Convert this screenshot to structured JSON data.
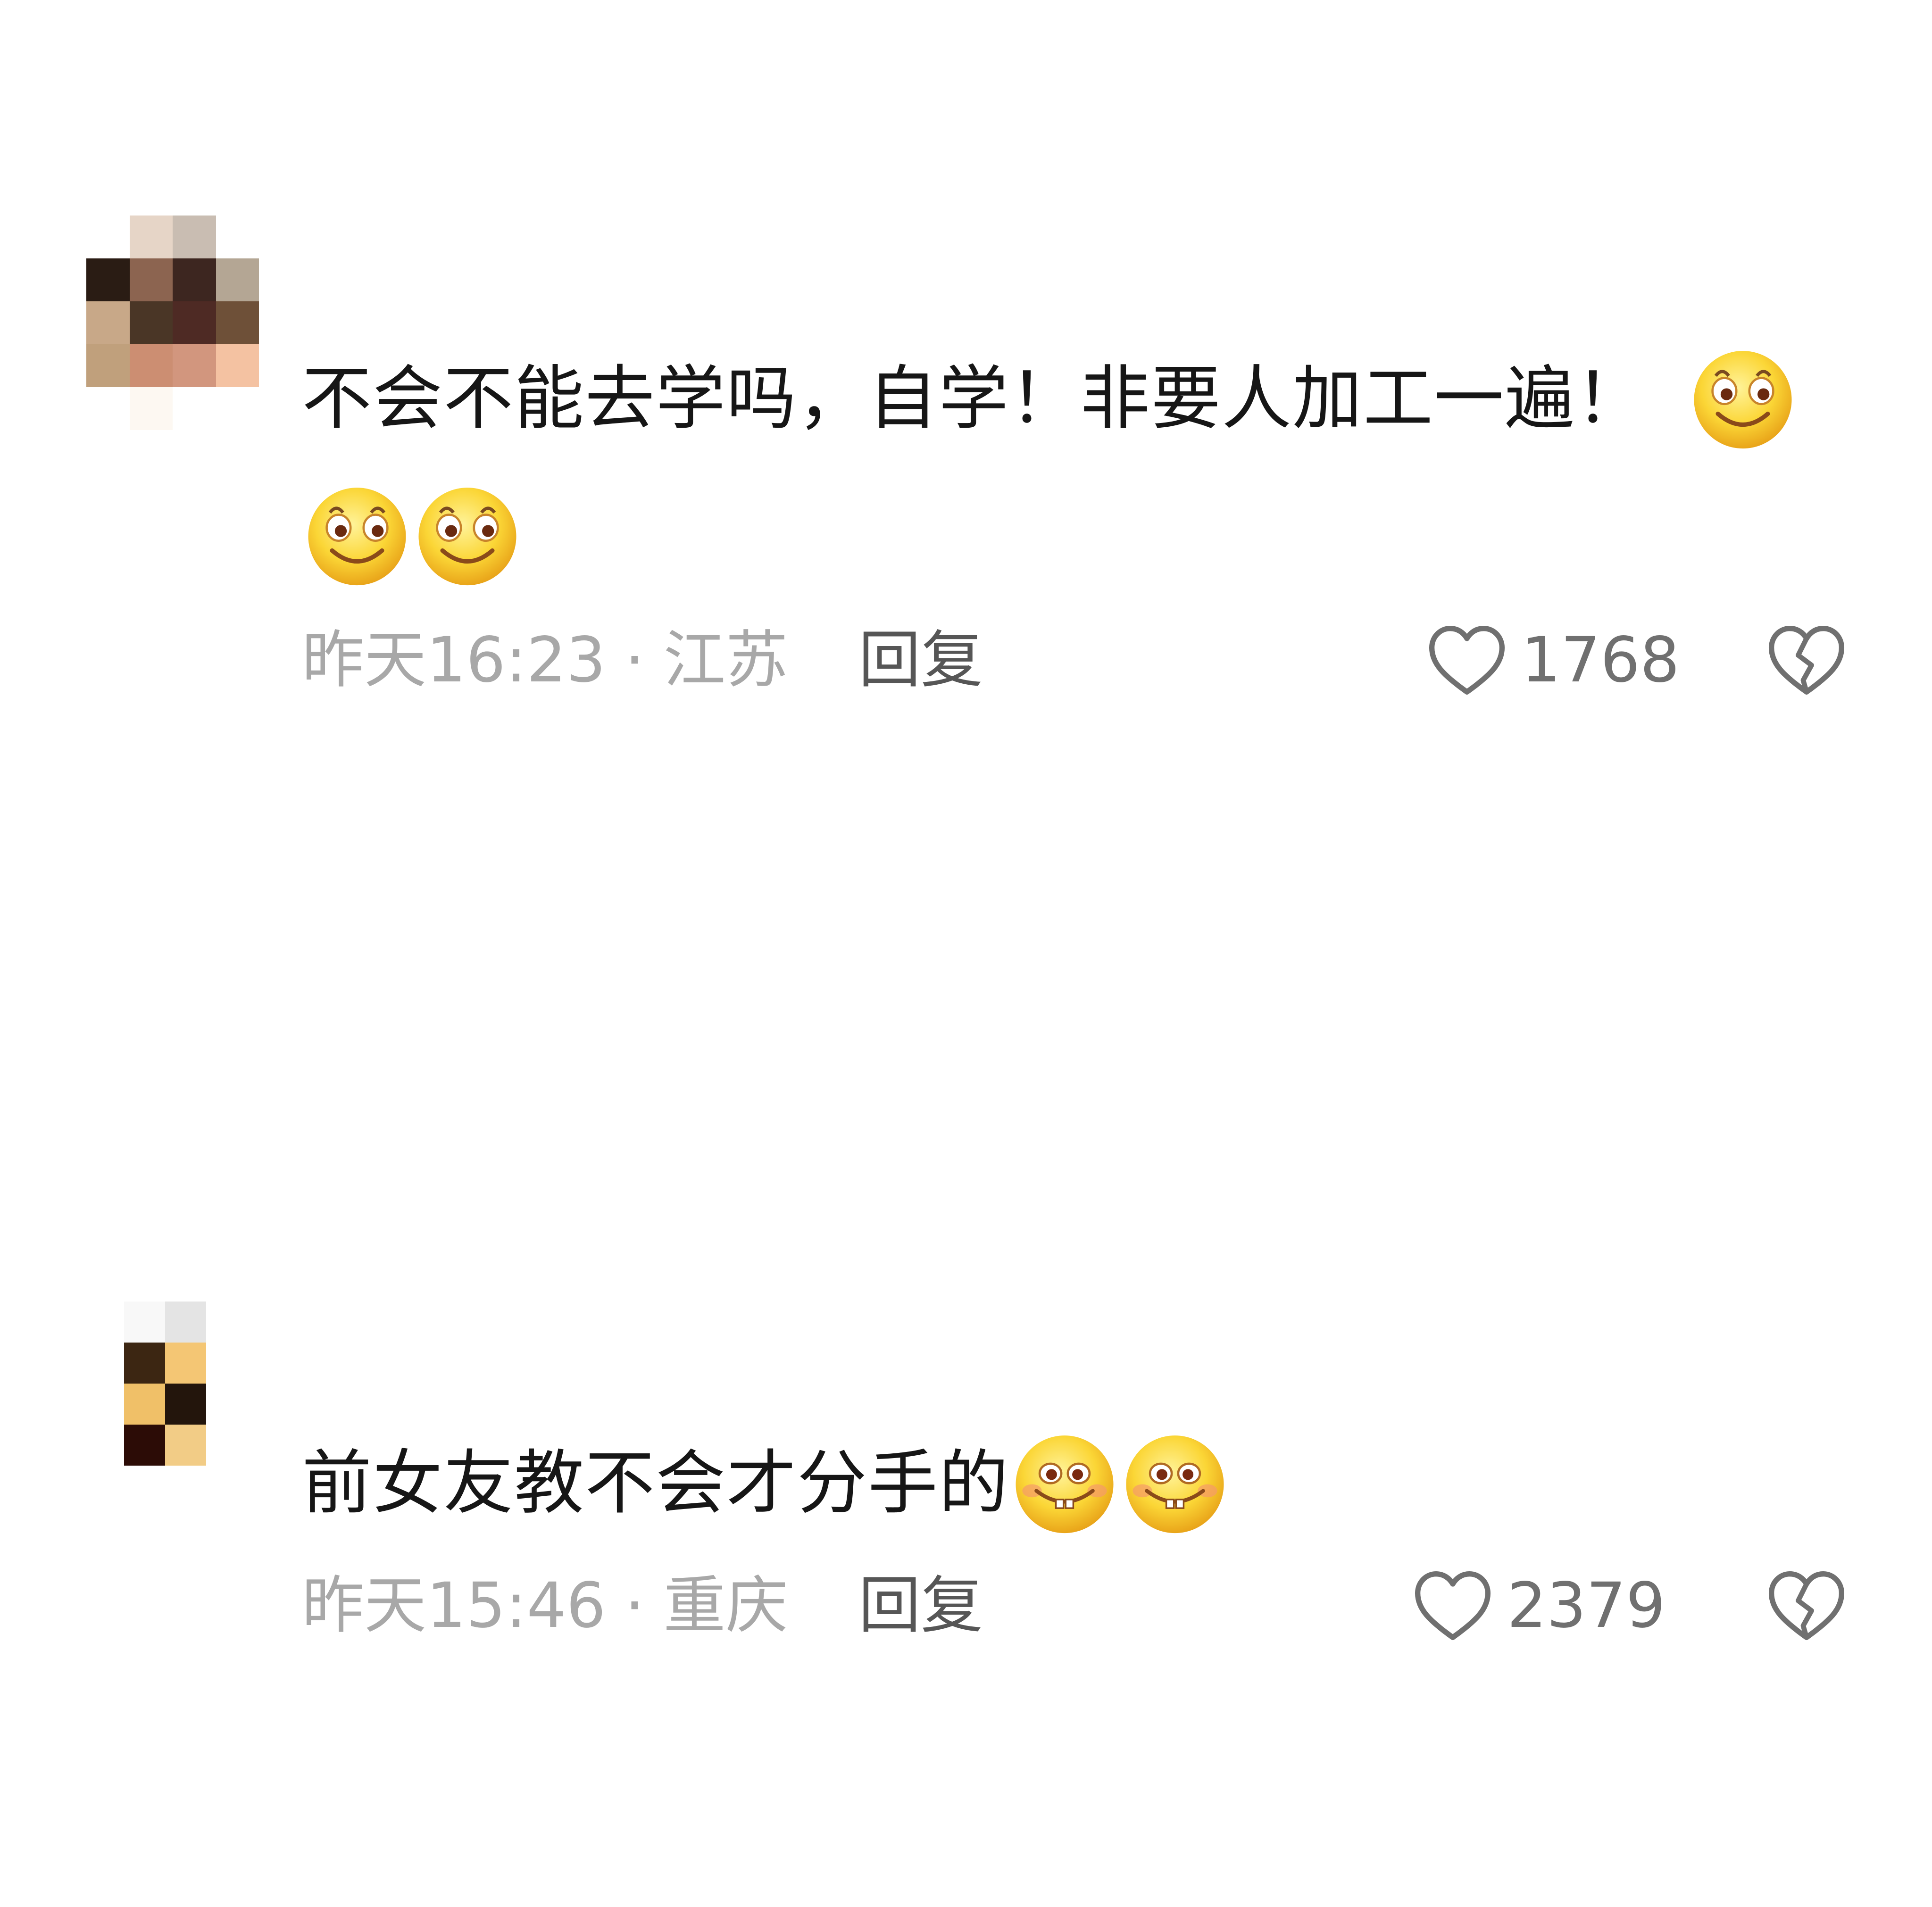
{
  "comments": [
    {
      "avatar": {
        "description": "pixelated-avatar",
        "colors": [
          [
            "#ffffff",
            "#e6d5c7",
            "#c9bdb2",
            "#ffffff"
          ],
          [
            "#2a1c14",
            "#8c6450",
            "#3d2620",
            "#b4a694"
          ],
          [
            "#c8a888",
            "#4a3626",
            "#4e2a24",
            "#6e5038"
          ],
          [
            "#c0a07c",
            "#cc8e72",
            "#d2967e",
            "#f4c2a2"
          ],
          [
            "#ffffff",
            "#fdf8f2",
            "#ffffff",
            "#ffffff"
          ]
        ]
      },
      "text": "不会不能去学吗，自学！非要人加工一遍！",
      "emojis": [
        "smile-emoji",
        "smile-emoji",
        "smile-emoji"
      ],
      "time": "昨天16:23",
      "separator": "·",
      "location": "江苏",
      "reply_label": "回复",
      "like_count": "1768"
    },
    {
      "avatar": {
        "description": "pixelated-avatar",
        "colors": [
          [
            "#f8f8f8",
            "#e4e4e4"
          ],
          [
            "#3c2612",
            "#f4c674"
          ],
          [
            "#f0c068",
            "#23150c"
          ],
          [
            "#2c0c06",
            "#f2cc86"
          ]
        ]
      },
      "text": "前女友教不会才分手的",
      "emojis": [
        "grin-emoji",
        "grin-emoji"
      ],
      "time": "昨天15:46",
      "separator": "·",
      "location": "重庆",
      "reply_label": "回复",
      "like_count": "2379"
    }
  ],
  "colors": {
    "background": "#ffffff",
    "text": "#161616",
    "meta_text": "#a8a8a8",
    "reply_text": "#565656",
    "icon": "#707070",
    "emoji_yellow": "#fbd636"
  }
}
